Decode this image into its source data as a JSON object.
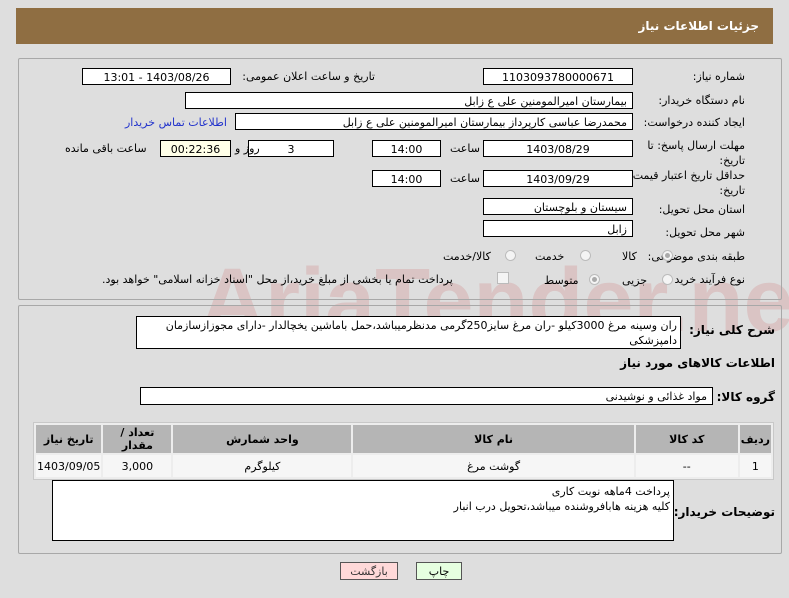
{
  "header": {
    "title": "جزئیات اطلاعات نیاز"
  },
  "form": {
    "need_number_label": "شماره نیاز:",
    "need_number": "1103093780000671",
    "announce_label": "تاریخ و ساعت اعلان عمومی:",
    "announce_value": "1403/08/26 - 13:01",
    "buyer_org_label": "نام دستگاه خریدار:",
    "buyer_org": "بیمارستان امیرالمومنین علی  ع  زابل",
    "creator_label": "ایجاد کننده درخواست:",
    "creator": "محمدرضا عباسی کارپرداز بیمارستان امیرالمومنین علی  ع  زابل",
    "contact_link": "اطلاعات تماس خریدار",
    "deadline_label": "مهلت ارسال پاسخ: تا تاریخ:",
    "deadline_date": "1403/08/29",
    "time_label": "ساعت",
    "deadline_time": "14:00",
    "days": "3",
    "days_label": "روز و",
    "remaining": "00:22:36",
    "remaining_label": "ساعت باقی مانده",
    "validity_label": "حداقل تاریخ اعتبار قیمت: تا تاریخ:",
    "validity_date": "1403/09/29",
    "validity_time": "14:00",
    "province_label": "استان محل تحویل:",
    "province": "سیستان و بلوچستان",
    "city_label": "شهر محل تحویل:",
    "city": "زابل",
    "category_label": "طبقه بندی موضوعی:",
    "category_options": [
      "کالا",
      "خدمت",
      "کالا/خدمت"
    ],
    "category_selected": "کالا",
    "process_label": "نوع فرآیند خرید :",
    "process_options": [
      "جزیی",
      "متوسط"
    ],
    "treasury_text": "پرداخت تمام یا بخشی از مبلغ خرید،از محل \"اسناد خزانه اسلامی\" خواهد بود."
  },
  "details": {
    "description_label": "شرح کلی نیاز:",
    "description": "ران وسینه مرغ 3000کیلو -ران مرغ سایز250گرمی مدنظرمیباشد،حمل باماشین یخچالدار -دارای مجوزازسازمان دامپزشکی",
    "goods_title": "اطلاعات کالاهای مورد نیاز",
    "group_label": "گروه کالا:",
    "group": "مواد غذائی و نوشیدنی",
    "table": {
      "headers": [
        "ردیف",
        "کد کالا",
        "نام کالا",
        "واحد شمارش",
        "تعداد / مقدار",
        "تاریخ نیاز"
      ],
      "rows": [
        [
          "1",
          "--",
          "گوشت مرغ",
          "کیلوگرم",
          "3,000",
          "1403/09/05"
        ]
      ]
    },
    "notes_label": "توضیحات خریدار:",
    "notes_line1": "پرداخت 4ماهه نوبت کاری",
    "notes_line2": "کلیه هزینه هابافروشنده میباشد،تحویل درب انبار"
  },
  "buttons": {
    "print": "چاپ",
    "back": "بازگشت"
  },
  "watermark": "AriaTender.neT"
}
